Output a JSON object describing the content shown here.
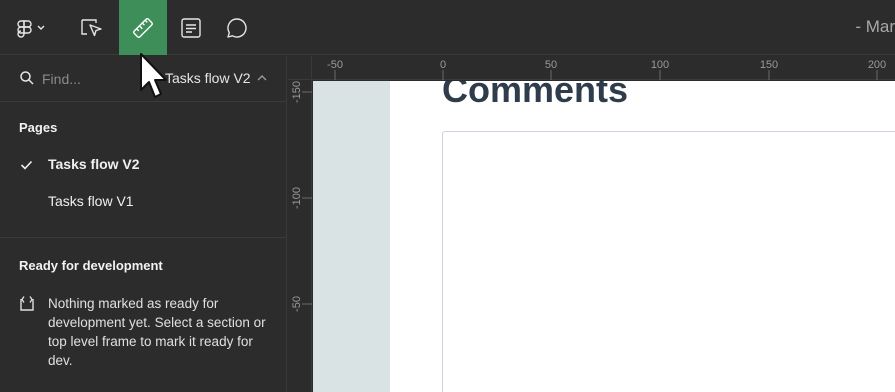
{
  "toolbar": {
    "title": "- Mar",
    "tools": [
      "figma-menu-icon",
      "move-tool-icon",
      "dev-mode-ruler-icon",
      "notes-icon",
      "comment-icon"
    ]
  },
  "sidebar": {
    "search": {
      "placeholder": "Find...",
      "value": ""
    },
    "current_page": "Tasks flow V2",
    "pages_title": "Pages",
    "pages": [
      {
        "label": "Tasks flow V2",
        "selected": true
      },
      {
        "label": "Tasks flow V1",
        "selected": false
      }
    ],
    "ready_title": "Ready for development",
    "ready_message": "Nothing marked as ready for development yet. Select a section or top level frame to mark it ready for dev."
  },
  "rulers": {
    "top": [
      "-50",
      "0",
      "50",
      "100",
      "150",
      "200"
    ],
    "left": [
      "-150",
      "-100",
      "-50"
    ]
  },
  "canvas": {
    "frame_title": "Comments"
  },
  "colors": {
    "accent": "#3d8e58",
    "background": "#2c2c2c",
    "canvas": "#d9e3e4"
  }
}
